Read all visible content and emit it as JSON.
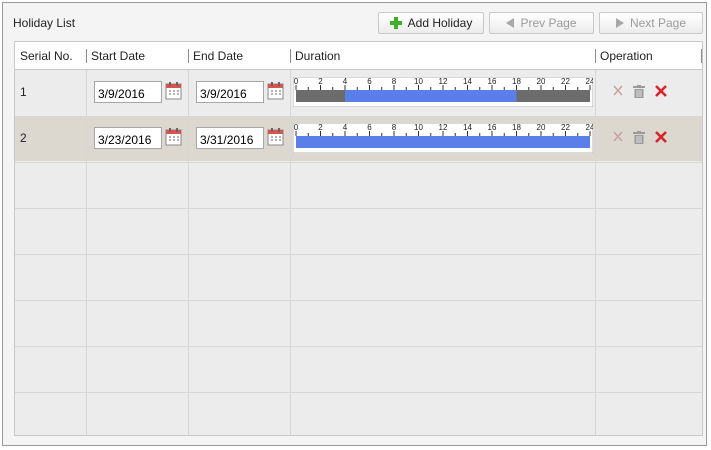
{
  "title": "Holiday List",
  "toolbar": {
    "add_label": "Add Holiday",
    "prev_label": "Prev Page",
    "next_label": "Next Page"
  },
  "columns": {
    "serial": "Serial No.",
    "start": "Start Date",
    "end": "End Date",
    "duration": "Duration",
    "operation": "Operation"
  },
  "timeline_ticks": [
    "0",
    "2",
    "4",
    "6",
    "8",
    "10",
    "12",
    "14",
    "16",
    "18",
    "20",
    "22",
    "24"
  ],
  "colors": {
    "active": "#5a7fe8",
    "inactive": "#6c6c6c",
    "selected_row": "#dcd8d0"
  },
  "rows": [
    {
      "serial": "1",
      "start_date": "3/9/2016",
      "end_date": "3/9/2016",
      "active_start_hour": 4,
      "active_end_hour": 18
    },
    {
      "serial": "2",
      "start_date": "3/23/2016",
      "end_date": "3/31/2016",
      "active_start_hour": 0,
      "active_end_hour": 24
    }
  ],
  "icons": {
    "calendar": "calendar-icon",
    "clear": "clear-icon",
    "delete": "trash-icon",
    "remove": "delete-x-icon"
  }
}
